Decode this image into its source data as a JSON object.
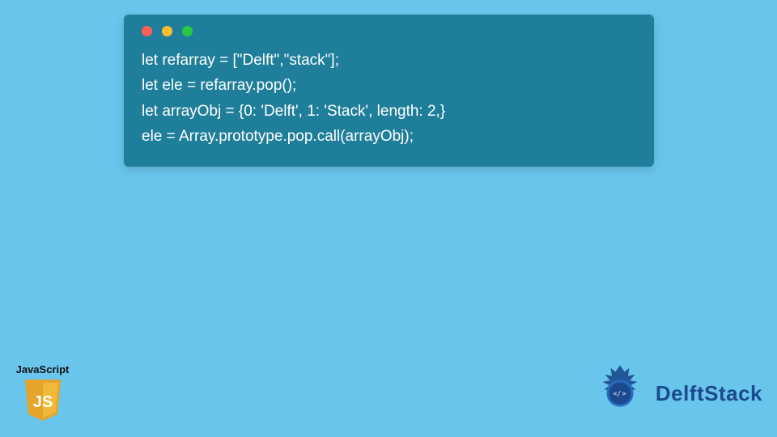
{
  "code_window": {
    "lines": [
      "let refarray = [\"Delft\",\"stack\"];",
      "let ele = refarray.pop();",
      "let arrayObj = {0: 'Delft', 1: 'Stack', length: 2,}",
      "ele = Array.prototype.pop.call(arrayObj);"
    ],
    "traffic_colors": {
      "red": "#ff5f56",
      "yellow": "#ffbd2e",
      "green": "#27c93f"
    },
    "bg": "#1f7f9b"
  },
  "js_badge": {
    "label": "JavaScript",
    "shield_bg": "#e5a42b",
    "js_text": "JS"
  },
  "brand": {
    "name": "DelftStack",
    "logo_color": "#1b4a8e"
  },
  "page_bg": "#6ac5ec"
}
